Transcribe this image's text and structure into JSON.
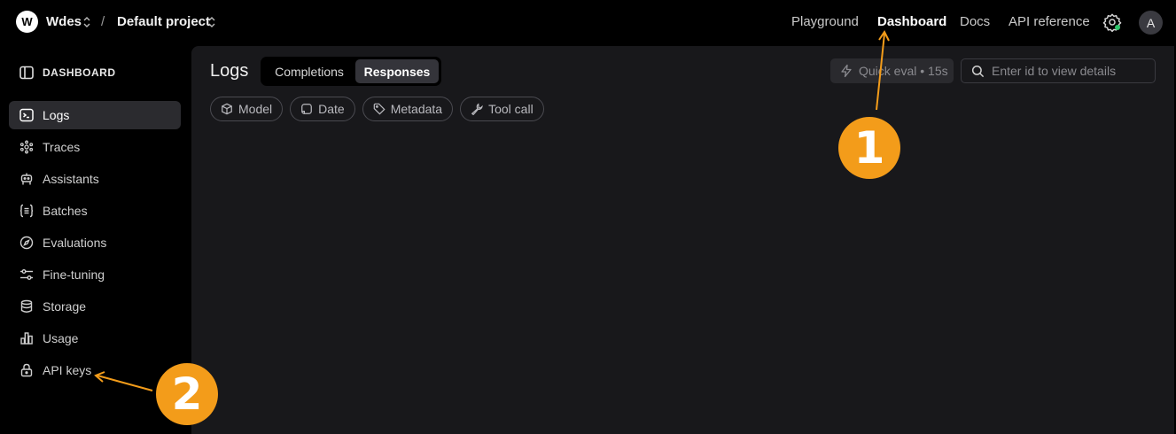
{
  "topbar": {
    "org_initial": "W",
    "org_name": "Wdes",
    "separator": "/",
    "project_name": "Default project",
    "nav": [
      {
        "label": "Playground"
      },
      {
        "label": "Dashboard"
      },
      {
        "label": "Docs"
      },
      {
        "label": "API reference"
      }
    ],
    "active_nav": "Dashboard",
    "user_initial": "A",
    "status_color": "#2ec66b"
  },
  "sidebar": {
    "header": "DASHBOARD",
    "items": [
      {
        "label": "Logs",
        "icon": "terminal-icon"
      },
      {
        "label": "Traces",
        "icon": "traces-icon"
      },
      {
        "label": "Assistants",
        "icon": "robot-icon"
      },
      {
        "label": "Batches",
        "icon": "batches-icon"
      },
      {
        "label": "Evaluations",
        "icon": "compass-icon"
      },
      {
        "label": "Fine-tuning",
        "icon": "sliders-icon"
      },
      {
        "label": "Storage",
        "icon": "database-icon"
      },
      {
        "label": "Usage",
        "icon": "bar-chart-icon"
      },
      {
        "label": "API keys",
        "icon": "lock-icon"
      }
    ],
    "active_item": "Logs"
  },
  "main": {
    "title": "Logs",
    "tabs": [
      {
        "label": "Completions"
      },
      {
        "label": "Responses"
      }
    ],
    "active_tab": "Responses",
    "quick_eval": "Quick eval • 15s",
    "search_placeholder": "Enter id to view details",
    "filters": [
      {
        "label": "Model",
        "icon": "cube-icon"
      },
      {
        "label": "Date",
        "icon": "calendar-icon"
      },
      {
        "label": "Metadata",
        "icon": "tag-icon"
      },
      {
        "label": "Tool call",
        "icon": "wrench-icon"
      }
    ]
  },
  "annotations": {
    "badge_1": "1",
    "badge_2": "2",
    "color": "#f39c1a"
  }
}
